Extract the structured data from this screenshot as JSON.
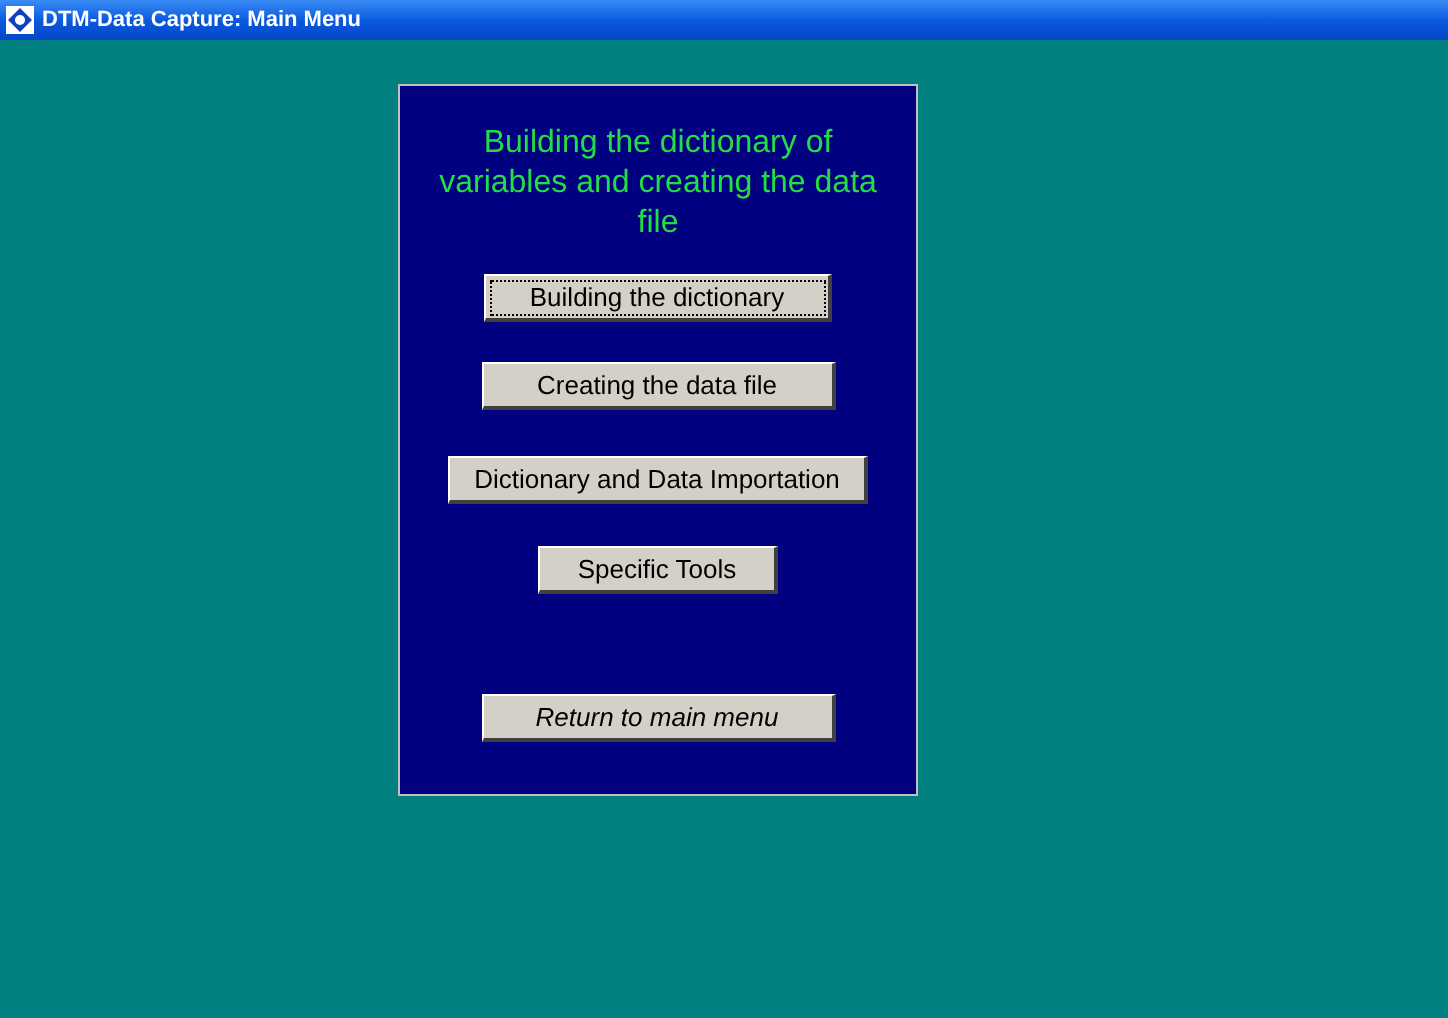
{
  "window": {
    "title": "DTM-Data Capture: Main Menu"
  },
  "panel": {
    "heading": "Building the dictionary of variables and creating the data file"
  },
  "buttons": [
    {
      "label": "Building the dictionary",
      "kind": "normal",
      "focused": true
    },
    {
      "label": "Creating the data file",
      "kind": "normal",
      "focused": false
    },
    {
      "label": "Dictionary and Data Importation",
      "kind": "normal",
      "focused": false
    },
    {
      "label": "Specific Tools",
      "kind": "normal",
      "focused": false
    },
    {
      "label": "Return to main menu",
      "kind": "return",
      "focused": false
    }
  ]
}
